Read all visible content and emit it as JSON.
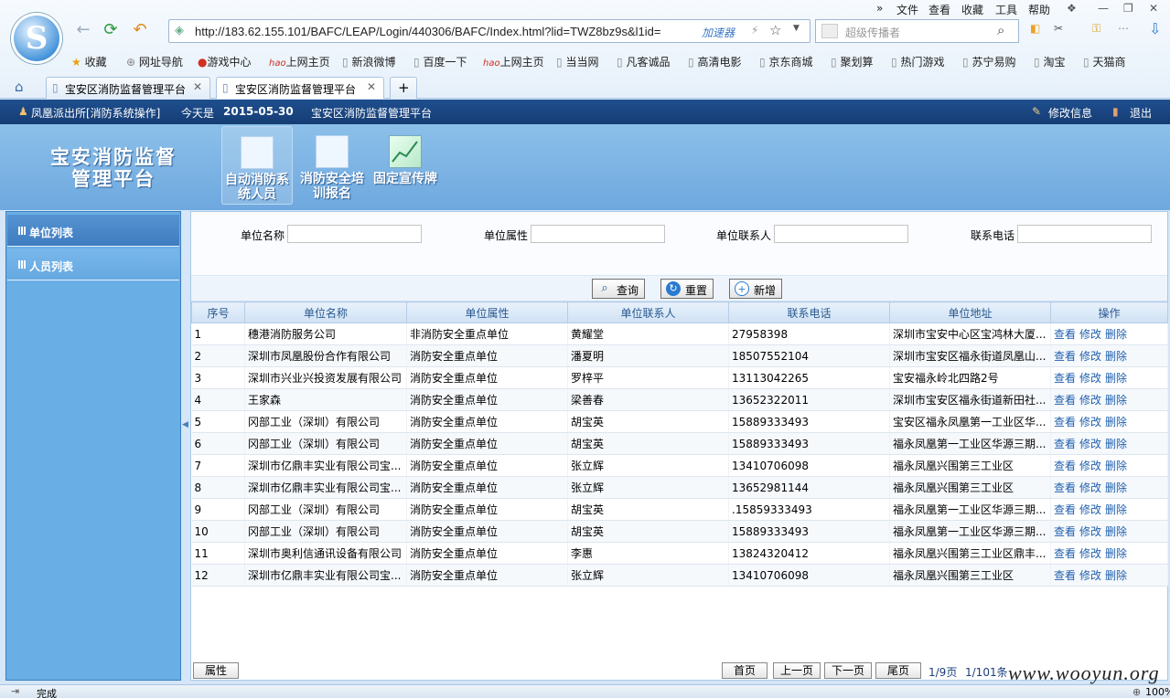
{
  "browser": {
    "url": "http://183.62.155.101/BAFC/LEAP/Login/440306/BAFC/Index.html?lid=TWZ8bz9s&l1id=",
    "accelerator": "加速器",
    "search_placeholder": "超级传播者",
    "menu": [
      "文件",
      "查看",
      "收藏",
      "工具",
      "帮助"
    ],
    "menu_prefix": "»",
    "bookmarks": [
      "收藏",
      "网址导航",
      "游戏中心",
      "上网主页",
      "新浪微博",
      "百度一下",
      "上网主页",
      "当当网",
      "凡客诚品",
      "高清电影",
      "京东商城",
      "聚划算",
      "热门游戏",
      "苏宁易购",
      "淘宝",
      "天猫商"
    ],
    "tabs": [
      "宝安区消防监督管理平台",
      "宝安区消防监督管理平台"
    ],
    "status": "完成",
    "zoom": "100%"
  },
  "topbar": {
    "user": "凤凰派出所[消防系统操作]",
    "date_prefix": "今天是",
    "date": "2015-05-30",
    "platform": "宝安区消防监督管理平台",
    "edit_info": "修改信息",
    "logout": "退出"
  },
  "header": {
    "title": "宝安消防监督管理平台",
    "modules": [
      "自动消防系统人员",
      "消防安全培训报名",
      "固定宣传牌"
    ]
  },
  "sidebar": {
    "items": [
      "单位列表",
      "人员列表"
    ]
  },
  "filter": {
    "labels": [
      "单位名称",
      "单位属性",
      "单位联系人",
      "联系电话"
    ],
    "search_button": "查询",
    "reset_button": "重置",
    "add_button": "新增"
  },
  "table": {
    "columns": [
      "序号",
      "单位名称",
      "单位属性",
      "单位联系人",
      "联系电话",
      "单位地址",
      "操作"
    ],
    "ops": [
      "查看",
      "修改",
      "删除"
    ],
    "rows": [
      [
        "1",
        "穗港消防服务公司",
        "非消防安全重点单位",
        "黄耀堂",
        "27958398",
        "深圳市宝安中心区宝鸿林大厦..."
      ],
      [
        "2",
        "深圳市凤凰股份合作有限公司",
        "消防安全重点单位",
        "潘夏明",
        "18507552104",
        "深圳市宝安区福永街道凤凰山..."
      ],
      [
        "3",
        "深圳市兴业兴投资发展有限公司",
        "消防安全重点单位",
        "罗梓平",
        "13113042265",
        "宝安福永岭北四路2号"
      ],
      [
        "4",
        "王家森",
        "消防安全重点单位",
        "梁善春",
        "13652322011",
        "深圳市宝安区福永街道新田社..."
      ],
      [
        "5",
        "冈部工业（深圳）有限公司",
        "消防安全重点单位",
        "胡宝英",
        "15889333493",
        "宝安区福永凤凰第一工业区华..."
      ],
      [
        "6",
        "冈部工业（深圳）有限公司",
        "消防安全重点单位",
        "胡宝英",
        "15889333493",
        "福永凤凰第一工业区华源三期..."
      ],
      [
        "7",
        "深圳市亿鼎丰实业有限公司宝...",
        "消防安全重点单位",
        "张立辉",
        "13410706098",
        "福永凤凰兴围第三工业区"
      ],
      [
        "8",
        "深圳市亿鼎丰实业有限公司宝...",
        "消防安全重点单位",
        "张立辉",
        "13652981144",
        "福永凤凰兴围第三工业区"
      ],
      [
        "9",
        "冈部工业（深圳）有限公司",
        "消防安全重点单位",
        "胡宝英",
        ".15859333493",
        "福永凤凰第一工业区华源三期..."
      ],
      [
        "10",
        "冈部工业（深圳）有限公司",
        "消防安全重点单位",
        "胡宝英",
        "15889333493",
        "福永凤凰第一工业区华源三期..."
      ],
      [
        "11",
        "深圳市奥利信通讯设备有限公司",
        "消防安全重点单位",
        "李惠",
        "13824320412",
        "福永凤凰兴围第三工业区鼎丰..."
      ],
      [
        "12",
        "深圳市亿鼎丰实业有限公司宝...",
        "消防安全重点单位",
        "张立辉",
        "13410706098",
        "福永凤凰兴围第三工业区"
      ]
    ]
  },
  "pager": {
    "attr_button": "属性",
    "first": "首页",
    "prev": "上一页",
    "next": "下一页",
    "last": "尾页",
    "page_info": "1/9页",
    "total_info": "1/101条"
  },
  "watermark": "www.wooyun.org"
}
